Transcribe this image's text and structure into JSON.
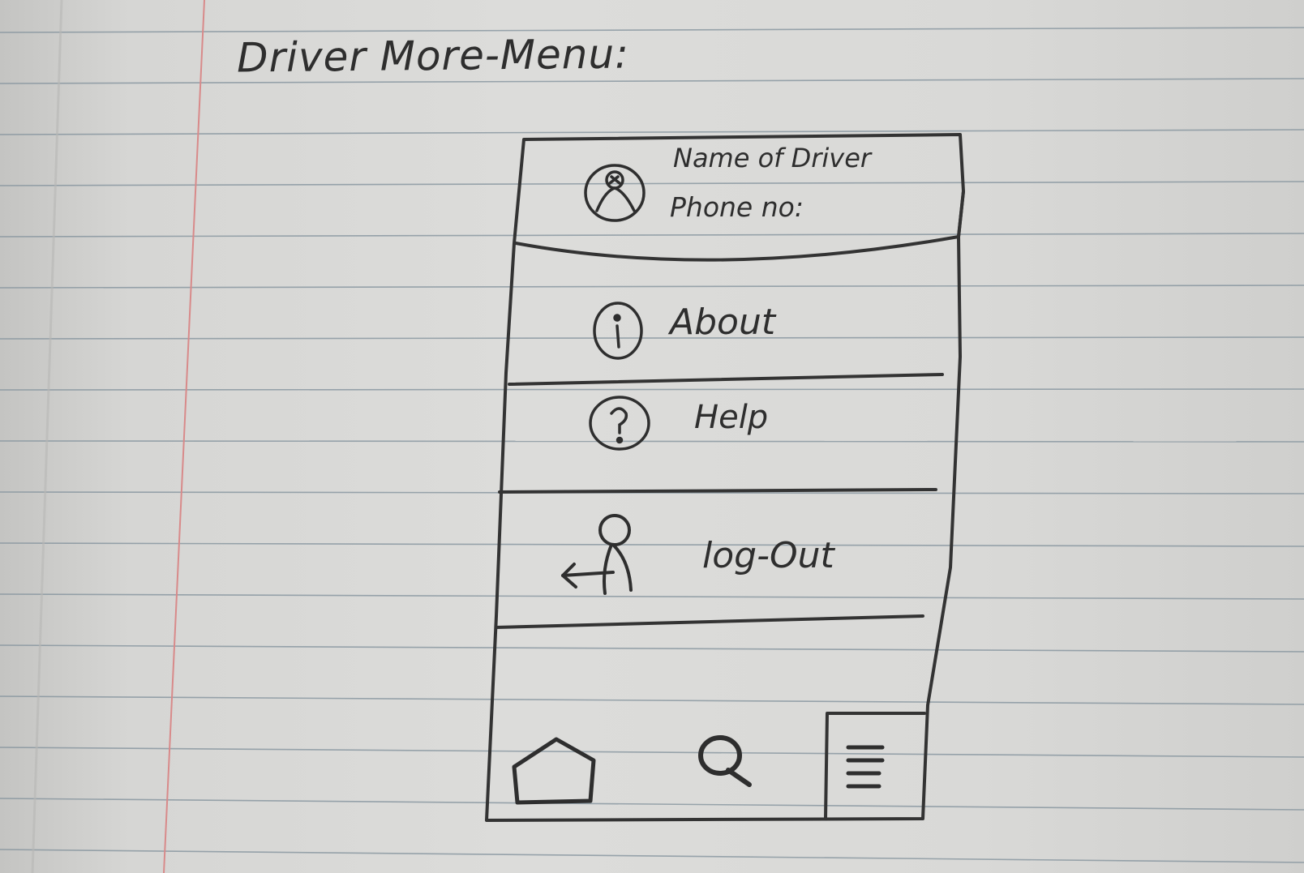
{
  "page": {
    "title": "Driver More-Menu:"
  },
  "profile": {
    "name_label": "Name of Driver",
    "phone_label": "Phone no:",
    "icon": "user-circle-icon"
  },
  "menu": {
    "items": [
      {
        "label": "About",
        "icon": "info-icon"
      },
      {
        "label": "Help",
        "icon": "question-icon"
      },
      {
        "label": "log-Out",
        "icon": "logout-icon"
      }
    ]
  },
  "bottom_nav": {
    "items": [
      {
        "icon": "home-icon"
      },
      {
        "icon": "search-icon"
      },
      {
        "icon": "menu-icon"
      }
    ]
  },
  "colors": {
    "ink": "#2e2e2e",
    "margin_line": "#d88a8a",
    "rule_line": "#7f8f9a"
  }
}
